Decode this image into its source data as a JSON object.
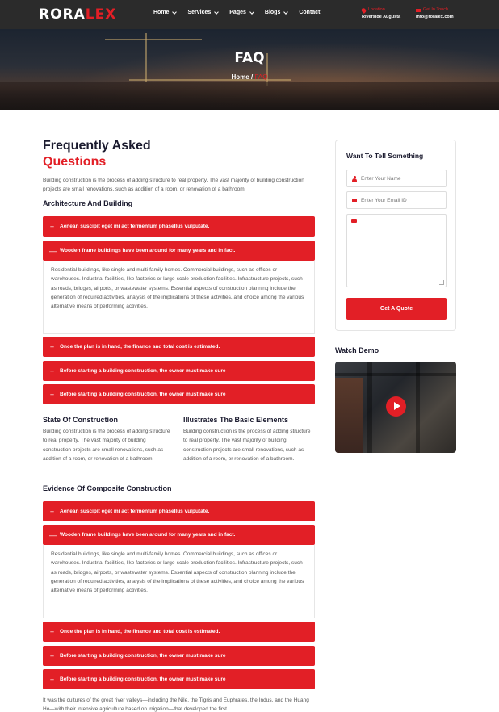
{
  "header": {
    "logo_part1": "RORA",
    "logo_part2": "LEX",
    "nav": [
      {
        "label": "Home",
        "dropdown": true
      },
      {
        "label": "Services",
        "dropdown": true
      },
      {
        "label": "Pages",
        "dropdown": true
      },
      {
        "label": "Blogs",
        "dropdown": true
      },
      {
        "label": "Contact",
        "dropdown": false
      }
    ],
    "location_label": "Location",
    "location_value": "Riverside Augusta",
    "contact_label": "Get In Touch",
    "contact_value": "info@roralex.com"
  },
  "hero": {
    "title": "FAQ",
    "crumb_home": "Home",
    "crumb_sep": " / ",
    "crumb_current": "FAQ"
  },
  "main": {
    "heading_line1": "Frequently Asked",
    "heading_line2": "Questions",
    "intro": "Building construction is the process of adding structure to real property. The vast majority of building construction projects are small renovations, such as addition of a room, or renovation of a bathroom.",
    "section1_title": "Architecture And Building",
    "section1": [
      {
        "q": "Aenean suscipit eget mi act fermentum phasellus vulputate.",
        "sym": "+"
      },
      {
        "q": "Wooden frame buildings have been around for many years and in fact.",
        "sym": "—"
      },
      {
        "q": "Once the plan is in hand, the finance and total cost is estimated.",
        "sym": "+"
      },
      {
        "q": "Before starting a building construction, the owner must make sure",
        "sym": "+"
      },
      {
        "q": "Before starting a building construction, the owner must make sure",
        "sym": "+"
      }
    ],
    "answer": "Residential buildings, like single and multi-family homes. Commercial buildings, such as offices or warehouses. Industrial facilities, like factories or large-scale production facilities. Infrastructure projects, such as roads, bridges, airports, or wastewater systems. Essential aspects of construction planning include the generation of required activities, analysis of the implications of these activities, and choice among the various alternative means of performing activities.",
    "col1_title": "State Of Construction",
    "col1_text": "Building construction is the process of adding structure to real property. The vast majority of building construction projects are small renovations, such as addition of a room, or renovation of a bathroom.",
    "col2_title": "Illustrates The Basic Elements",
    "col2_text": "Building construction is the process of adding structure to real property. The vast majority of building construction projects are small renovations, such as addition of a room, or renovation of a bathroom.",
    "section2_title": "Evidence Of Composite Construction",
    "section2": [
      {
        "q": "Aenean suscipit eget mi act fermentum phasellus vulputate.",
        "sym": "+"
      },
      {
        "q": "Wooden frame buildings have been around for many years and in fact.",
        "sym": "—"
      },
      {
        "q": "Once the plan is in hand, the finance and total cost is estimated.",
        "sym": "+"
      },
      {
        "q": "Before starting a building construction, the owner must make sure",
        "sym": "+"
      },
      {
        "q": "Before starting a building construction, the owner must make sure",
        "sym": "+"
      }
    ],
    "bottom_text": "It was the cultures of the great river valleys—including the Nile, the Tigris and Euphrates, the Indus, and the Huang Ho—with their intensive agriculture based on irrigation—that developed the first"
  },
  "sidebar": {
    "form_title": "Want To Tell Something",
    "name_placeholder": "Enter Your Name",
    "email_placeholder": "Enter Your Email ID",
    "submit_label": "Get A Quote",
    "watch_title": "Watch Demo"
  },
  "colors": {
    "accent": "#e21f26",
    "dark": "#2b2b2b",
    "heading": "#1b1b2f"
  }
}
